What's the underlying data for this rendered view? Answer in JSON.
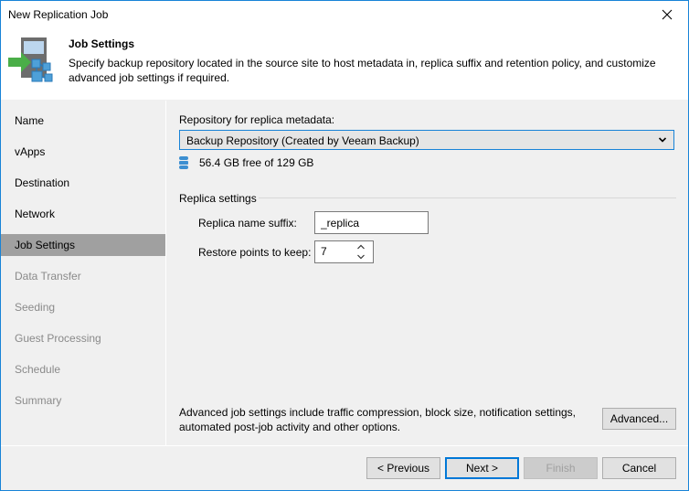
{
  "window": {
    "title": "New Replication Job",
    "close_icon": "close-icon"
  },
  "header": {
    "icon": "replication-job-icon",
    "title": "Job Settings",
    "description": "Specify backup repository located in the source site to host metadata in, replica suffix and retention policy, and customize advanced job settings if required."
  },
  "sidebar": {
    "items": [
      {
        "label": "Name",
        "state": "enabled"
      },
      {
        "label": "vApps",
        "state": "enabled"
      },
      {
        "label": "Destination",
        "state": "enabled"
      },
      {
        "label": "Network",
        "state": "enabled"
      },
      {
        "label": "Job Settings",
        "state": "active"
      },
      {
        "label": "Data Transfer",
        "state": "disabled"
      },
      {
        "label": "Seeding",
        "state": "disabled"
      },
      {
        "label": "Guest Processing",
        "state": "disabled"
      },
      {
        "label": "Schedule",
        "state": "disabled"
      },
      {
        "label": "Summary",
        "state": "disabled"
      }
    ]
  },
  "main": {
    "repository_label": "Repository for replica metadata:",
    "repository_selected": "Backup Repository (Created by Veeam Backup)",
    "repository_free": "56.4 GB free of 129 GB",
    "replica_group_label": "Replica settings",
    "suffix_label": "Replica name suffix:",
    "suffix_value": "_replica",
    "restore_points_label": "Restore points to keep:",
    "restore_points_value": "7",
    "advanced_text": "Advanced job settings include traffic compression, block size, notification settings, automated post-job activity and other options.",
    "advanced_button": "Advanced..."
  },
  "footer": {
    "previous": "< Previous",
    "next": "Next >",
    "finish": "Finish",
    "cancel": "Cancel"
  },
  "colors": {
    "accent": "#0078d7",
    "active_nav": "#a0a0a0",
    "disabled_text": "#8a8a8a",
    "window_border": "#1883d7"
  }
}
